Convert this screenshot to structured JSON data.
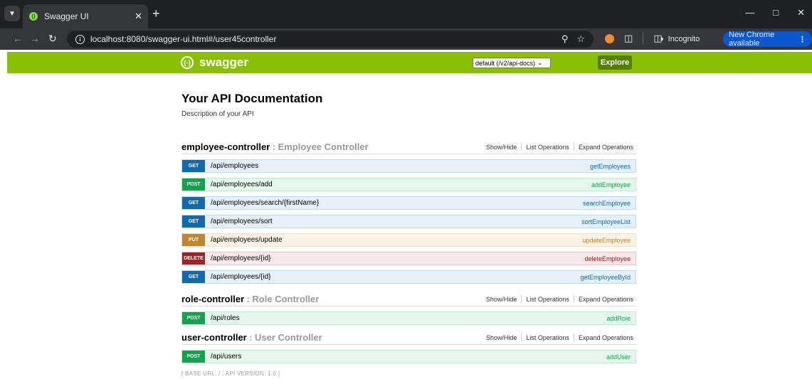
{
  "browser": {
    "tab_title": "Swagger UI",
    "url": "localhost:8080/swagger-ui.html#/user45controller",
    "incognito_label": "Incognito",
    "update_label": "New Chrome available"
  },
  "header": {
    "logo_text": "swagger",
    "spec_selected": "default (/v2/api-docs)",
    "explore_label": "Explore",
    "brand_color": "#89bf04"
  },
  "api": {
    "title": "Your API Documentation",
    "description": "Description of your API"
  },
  "controller_actions": [
    "Show/Hide",
    "List Operations",
    "Expand Operations"
  ],
  "controllers": [
    {
      "name": "employee-controller",
      "description": ": Employee Controller",
      "operations": [
        {
          "method": "GET",
          "path": "/api/employees",
          "nickname": "getEmployees"
        },
        {
          "method": "POST",
          "path": "/api/employees/add",
          "nickname": "addEmployee"
        },
        {
          "method": "GET",
          "path": "/api/employees/search/{firstName}",
          "nickname": "searchEmployee"
        },
        {
          "method": "GET",
          "path": "/api/employees/sort",
          "nickname": "sortEmployeeList"
        },
        {
          "method": "PUT",
          "path": "/api/employees/update",
          "nickname": "updateEmployee"
        },
        {
          "method": "DELETE",
          "path": "/api/employees/{id}",
          "nickname": "deleteEmployee"
        },
        {
          "method": "GET",
          "path": "/api/employees/{id}",
          "nickname": "getEmployeeById"
        }
      ]
    },
    {
      "name": "role-controller",
      "description": ": Role Controller",
      "operations": [
        {
          "method": "POST",
          "path": "/api/roles",
          "nickname": "addRole"
        }
      ]
    },
    {
      "name": "user-controller",
      "description": ": User Controller",
      "operations": [
        {
          "method": "POST",
          "path": "/api/users",
          "nickname": "addUser"
        }
      ]
    }
  ],
  "footer": {
    "text": "[ BASE URL: / , API VERSION: 1.0 ]"
  }
}
